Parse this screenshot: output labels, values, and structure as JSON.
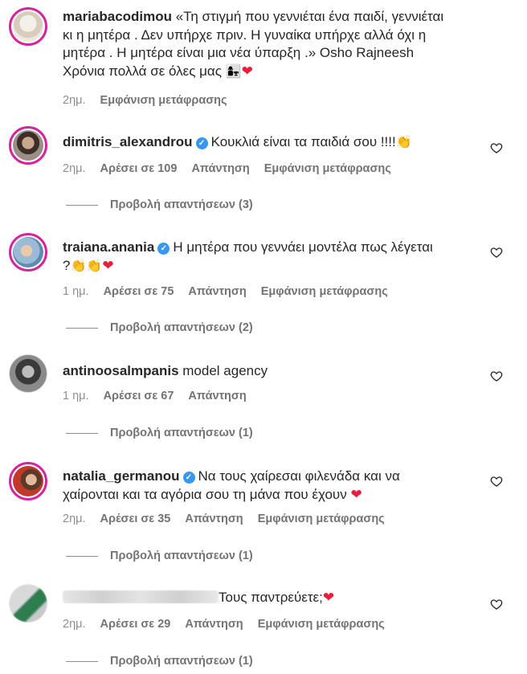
{
  "comments": [
    {
      "username": "mariabacodimou",
      "verified": false,
      "text_lines": [
        "«Τη στιγμή που γεννιέται ένα παιδί, γεννιέται",
        "κι η μητέρα . Δεν υπήρχε πριν. Η γυναίκα υπήρχε αλλά όχι η",
        "μητέρα . Η μητέρα είναι μια νέα ύπαρξη .» Osho Rajneesh",
        "Χρόνια πολλά σε όλες μας"
      ],
      "emoji": "👩‍👧",
      "time": "2ημ.",
      "likes": "",
      "reply": "",
      "translate": "Εμφάνιση μετάφρασης",
      "view_replies": "",
      "avatar_color": "#e9e3da"
    },
    {
      "username": "dimitris_alexandrou",
      "verified": true,
      "text": "Κουκλιά είναι τα παιδιά σου !!!!",
      "emoji": "👏",
      "time": "2ημ.",
      "likes": "Αρέσει σε 109",
      "reply": "Απάντηση",
      "translate": "Εμφάνιση μετάφρασης",
      "view_replies": "Προβολή απαντήσεων (3)",
      "avatar_color": "#5b4a3f"
    },
    {
      "username": "traiana.anania",
      "verified": true,
      "text": "Η μητέρα που γεννάει μοντέλα πως λέγεται",
      "text2": "?",
      "emoji": "👏👏",
      "time": "1 ημ.",
      "likes": "Αρέσει σε 75",
      "reply": "Απάντηση",
      "translate": "Εμφάνιση μετάφρασης",
      "view_replies": "Προβολή απαντήσεων (2)",
      "avatar_color": "#7fa6c7"
    },
    {
      "username": "antinoosalmpanis",
      "verified": false,
      "text": "model agency",
      "time": "1 ημ.",
      "likes": "Αρέσει σε 67",
      "reply": "Απάντηση",
      "translate": "",
      "view_replies": "Προβολή απαντήσεων (1)",
      "avatar_color": "#6e6e6e"
    },
    {
      "username": "natalia_germanou",
      "verified": true,
      "text": "Να τους χαίρεσαι φιλενάδα και να",
      "text2": "χαίρονται και τα αγόρια σου τη μάνα που έχουν",
      "time": "2ημ.",
      "likes": "Αρέσει σε 35",
      "reply": "Απάντηση",
      "translate": "Εμφάνιση μετάφρασης",
      "view_replies": "Προβολή απαντήσεων (1)",
      "avatar_color": "#c0392b"
    },
    {
      "username": "",
      "verified": false,
      "text": "Τους παντρεύετε;",
      "time": "2ημ.",
      "likes": "Αρέσει σε 29",
      "reply": "Απάντηση",
      "translate": "Εμφάνιση μετάφρασης",
      "view_replies": "Προβολή απαντήσεων (1)",
      "avatar_color": "#2e7d4f"
    }
  ],
  "colors": {
    "text": "#262626",
    "meta": "#8e8e8e",
    "verified": "#3897f0",
    "heart": "#ed1c3a",
    "story_ring": "#d6249f"
  },
  "icons": {
    "like": "heart-outline-icon",
    "verified": "verified-badge-icon",
    "heart_emoji": "red-heart-emoji"
  }
}
